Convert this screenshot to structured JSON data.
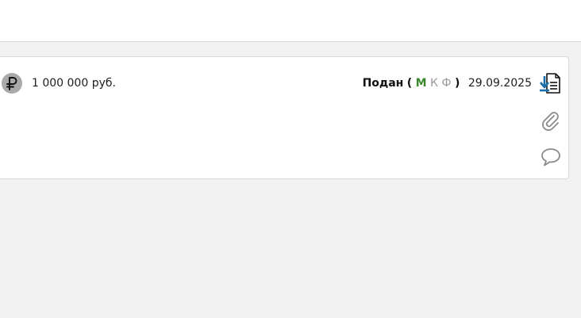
{
  "card": {
    "amount": "1 000 000 руб.",
    "status": {
      "label": "Подан",
      "open_paren": "(",
      "m": "М",
      "k": "К",
      "f": "Ф",
      "close_paren": ")",
      "date": "29.09.2025"
    },
    "icons": {
      "currency": "ruble-icon",
      "download": "download-document-icon",
      "attachment": "paperclip-icon",
      "comment": "comment-icon"
    }
  },
  "colors": {
    "page_bg": "#f1f1f1",
    "card_bg": "#ffffff",
    "status_m": "#3a8a2c",
    "status_inactive": "#9a9a9a",
    "download_accent": "#1a6fa8"
  }
}
